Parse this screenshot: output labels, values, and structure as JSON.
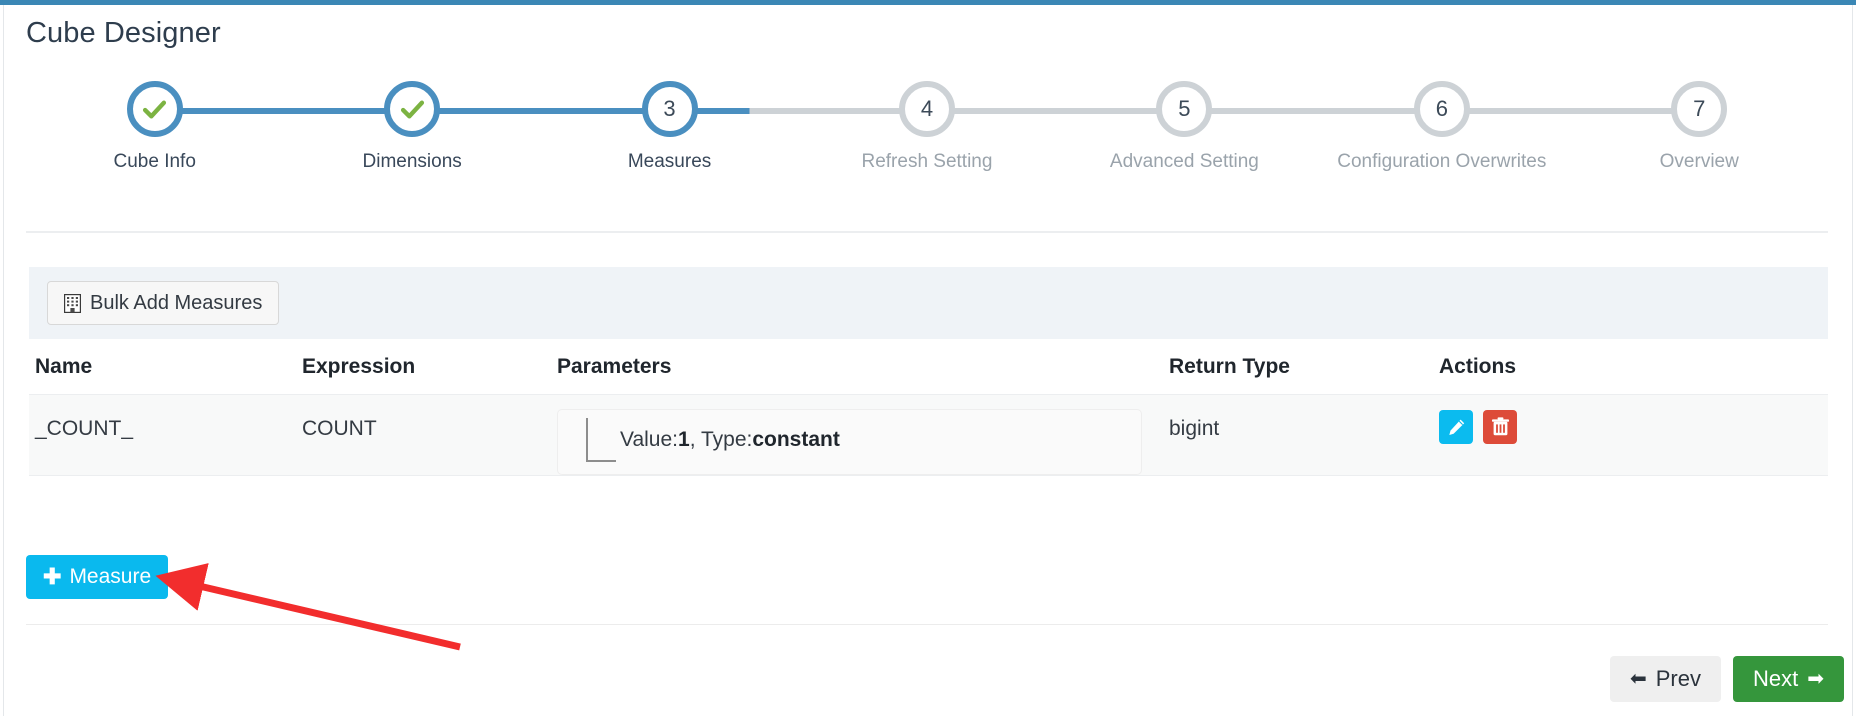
{
  "theme": {
    "accent_blue": "#3b87b5",
    "step_active": "#4a8fc0",
    "step_inactive": "#cdd2d6",
    "check_green": "#7cb342",
    "edit_cyan": "#0bbbef",
    "delete_red": "#dd4b39",
    "measure_blue": "#0ab9ee",
    "next_green": "#35963c",
    "annotation_red": "#f22d2d"
  },
  "page": {
    "title": "Cube Designer"
  },
  "stepper": {
    "steps": [
      {
        "number": "1",
        "label": "Cube Info",
        "state": "done",
        "icon": "check-icon"
      },
      {
        "number": "2",
        "label": "Dimensions",
        "state": "done",
        "icon": "check-icon"
      },
      {
        "number": "3",
        "label": "Measures",
        "state": "active",
        "icon": ""
      },
      {
        "number": "4",
        "label": "Refresh Setting",
        "state": "pending",
        "icon": ""
      },
      {
        "number": "5",
        "label": "Advanced Setting",
        "state": "pending",
        "icon": ""
      },
      {
        "number": "6",
        "label": "Configuration Overwrites",
        "state": "pending",
        "icon": ""
      },
      {
        "number": "7",
        "label": "Overview",
        "state": "pending",
        "icon": ""
      }
    ]
  },
  "toolbar": {
    "bulk_add_label": "Bulk Add Measures",
    "bulk_add_icon": "building-icon"
  },
  "table": {
    "columns": [
      "Name",
      "Expression",
      "Parameters",
      "Return Type",
      "Actions"
    ],
    "rows": [
      {
        "name": "_COUNT_",
        "expression": "COUNT",
        "parameter_prefix": "Value:",
        "parameter_value": "1",
        "parameter_mid": ", Type:",
        "parameter_type": "constant",
        "return_type": "bigint",
        "actions": [
          {
            "name": "edit-button",
            "icon": "pencil-icon"
          },
          {
            "name": "delete-button",
            "icon": "trash-icon"
          }
        ]
      }
    ]
  },
  "add_measure": {
    "label": "Measure",
    "plus": "✚"
  },
  "nav": {
    "prev_label": "Prev",
    "prev_arrow": "➡",
    "next_label": "Next",
    "next_arrow": "➡"
  },
  "annotation": {
    "type": "arrow",
    "points_to": "add-measure-button"
  }
}
